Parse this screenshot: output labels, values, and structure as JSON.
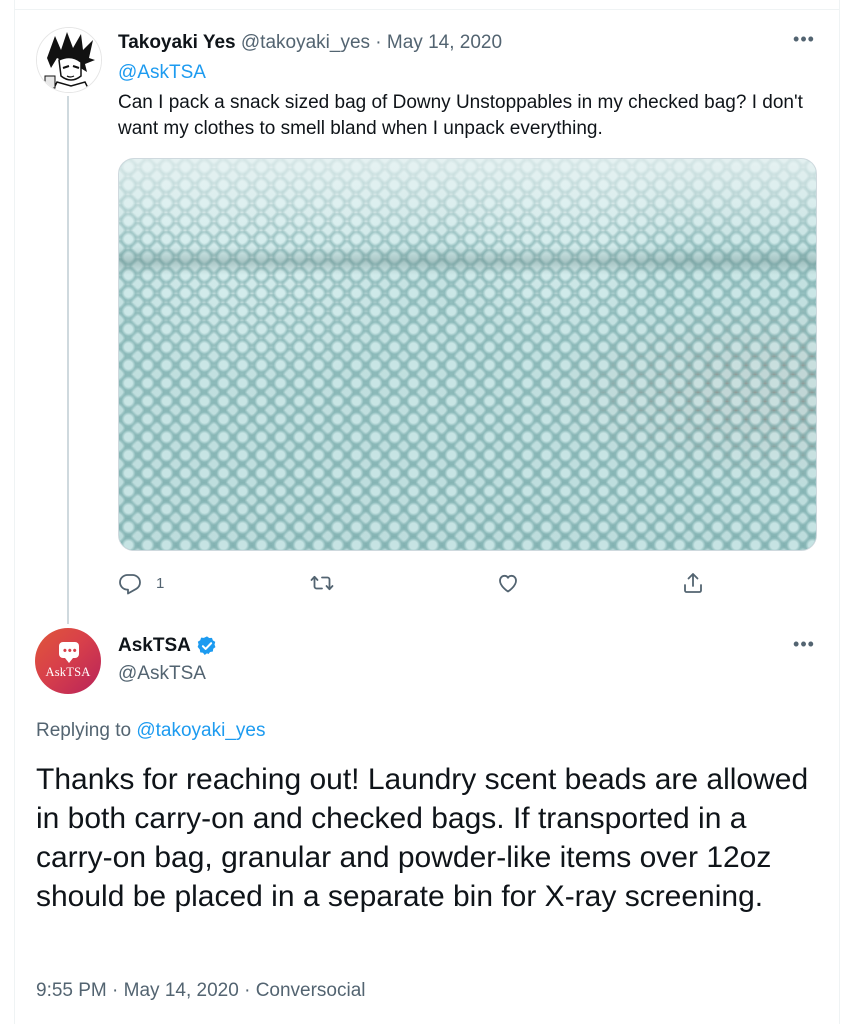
{
  "tweet1": {
    "display_name": "Takoyaki Yes",
    "handle": "@takoyaki_yes",
    "separator": "·",
    "date": "May 14, 2020",
    "more_label": "•••",
    "mention": "@AskTSA",
    "text": "Can I pack a snack sized bag of Downy Unstoppables in my checked bag? I don't want my clothes to smell bland when I unpack everything.",
    "media_alt": "photo of light blue scent beads in a plastic bag",
    "reply_count": "1",
    "colors": {
      "accent": "#1d9bf0",
      "muted": "#536471"
    }
  },
  "tweet2": {
    "display_name": "AskTSA",
    "handle": "@AskTSA",
    "more_label": "•••",
    "avatar_text": "AskTSA",
    "verified_icon": "verified-badge-icon",
    "replying_prefix": "Replying to",
    "replying_handle": "@takoyaki_yes",
    "text": "Thanks for reaching out! Laundry scent beads are allowed in both carry-on and checked bags. If transported in a carry-on bag, granular and powder-like items over 12oz should be placed in a separate bin for X-ray screening.",
    "time": "9:55 PM",
    "separator": "·",
    "date": "May 14, 2020",
    "source": "Conversocial",
    "colors": {
      "avatar_start": "#e0573a",
      "avatar_end": "#b8235a",
      "verified": "#1d9bf0"
    }
  }
}
